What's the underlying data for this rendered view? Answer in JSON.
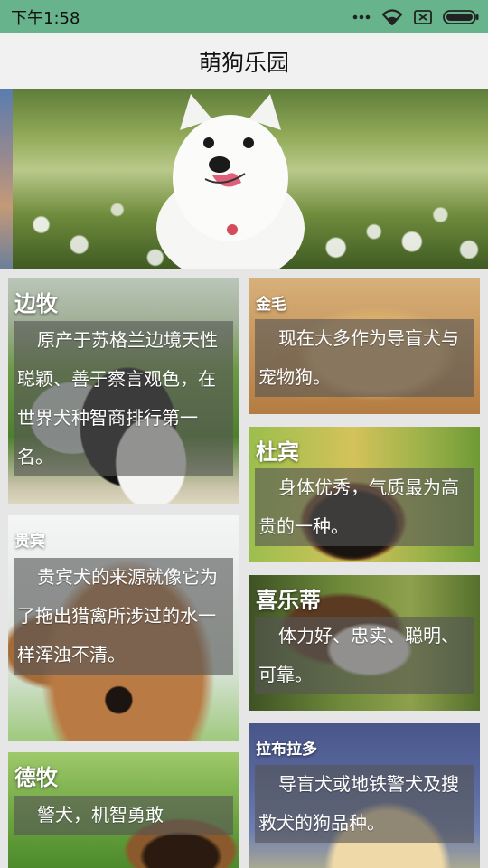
{
  "status_bar": {
    "time": "下午1:58",
    "icons": [
      "dots-icon",
      "wifi-icon",
      "sim-icon",
      "battery-icon"
    ]
  },
  "header": {
    "title": "萌狗乐园"
  },
  "banner": {
    "subject": "white-samoyed-dog-photo"
  },
  "breeds": [
    {
      "name": "边牧",
      "description": "原产于苏格兰边境天性聪颖、善于察言观色，在世界犬种智商排行第一名。",
      "photo": "border-collie-photo"
    },
    {
      "name": "金毛",
      "description": "现在大多作为导盲犬与宠物狗。",
      "photo": "golden-retriever-photo"
    },
    {
      "name": "杜宾",
      "description": "身体优秀，气质最为高贵的一种。",
      "photo": "doberman-photo"
    },
    {
      "name": "贵宾",
      "description": "贵宾犬的来源就像它为了拖出猎禽所涉过的水一样浑浊不清。",
      "photo": "poodle-photo"
    },
    {
      "name": "喜乐蒂",
      "description": "体力好、忠实、聪明、可靠。",
      "photo": "papillon-photo"
    },
    {
      "name": "德牧",
      "description": "警犬，机智勇敢",
      "photo": "german-shepherd-photo"
    },
    {
      "name": "拉布拉多",
      "description": "导盲犬或地铁警犬及搜救犬的狗品种。",
      "photo": "labrador-photo"
    }
  ],
  "colors": {
    "status_bar": "#66b38c",
    "title_bar": "#f1f1f1",
    "background": "#e6e6e6",
    "overlay": "rgba(85,85,85,0.62)"
  }
}
